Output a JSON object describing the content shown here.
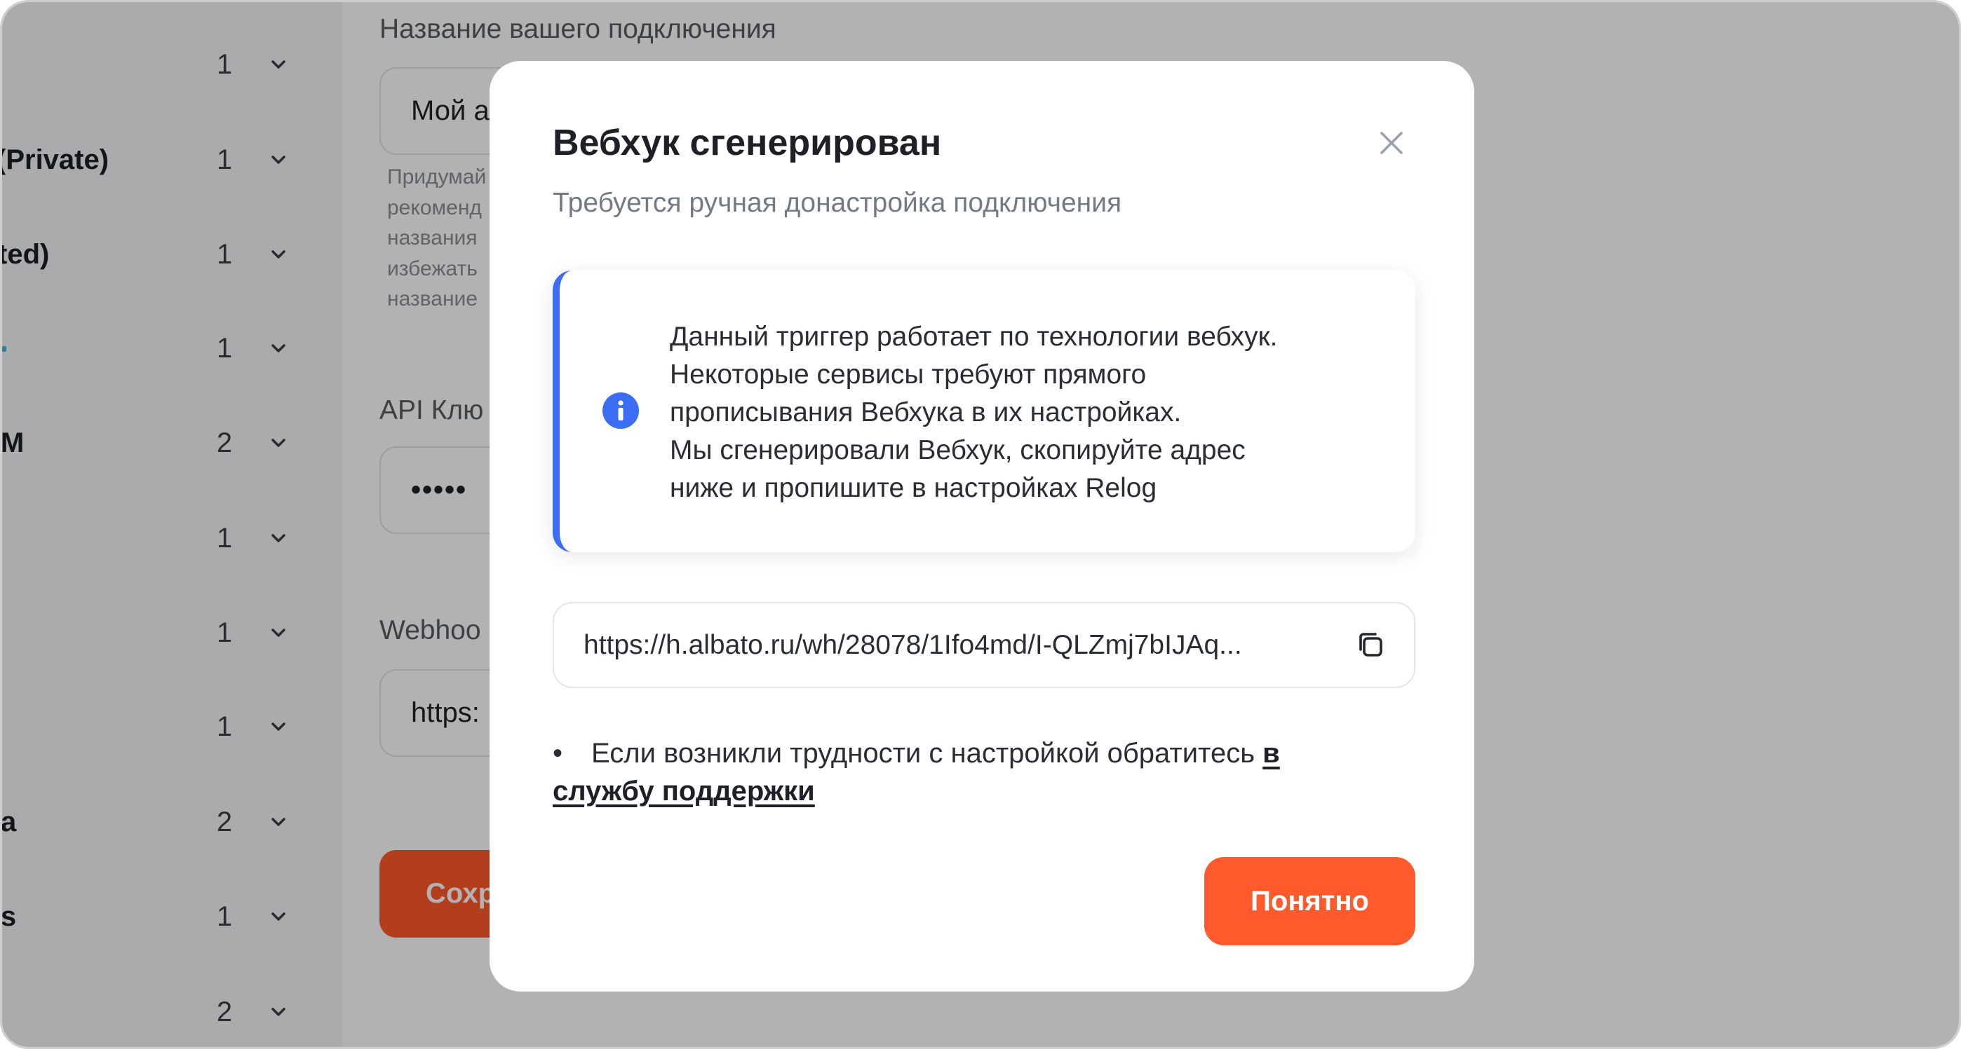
{
  "colors": {
    "accent": "#ff5a2c",
    "info": "#3b6ef5",
    "overlay": "rgba(0,0,0,0.30)"
  },
  "icons": [
    "chevron-down-icon",
    "close-icon",
    "info-icon",
    "copy-icon"
  ],
  "sidebar": {
    "items": [
      {
        "label": "",
        "count": "1"
      },
      {
        "label": "(Private)",
        "count": "1"
      },
      {
        "label": "ted)",
        "count": "1"
      },
      {
        "label": "",
        "count": "1"
      },
      {
        "label": "M",
        "count": "2"
      },
      {
        "label": "",
        "count": "1"
      },
      {
        "label": "",
        "count": "1"
      },
      {
        "label": "",
        "count": "1"
      },
      {
        "label": "a",
        "count": "2"
      },
      {
        "label": "s",
        "count": "1"
      },
      {
        "label": "",
        "count": "2"
      }
    ]
  },
  "form": {
    "connection_name": {
      "label": "Название вашего подключения",
      "value": "Мой а",
      "helper_lines": [
        "Придумай",
        "рекоменд",
        "названия",
        "избежать",
        "название"
      ]
    },
    "api_key": {
      "label": "API Клю",
      "value": "•••••"
    },
    "webhook": {
      "label": "Webhoo",
      "value": "https:"
    },
    "save_button": "Сохр"
  },
  "modal": {
    "title": "Вебхук сгенерирован",
    "subtitle": "Требуется ручная донастройка подключения",
    "info_lines": [
      "Данный триггер работает по технологии вебхук.",
      "Некоторые сервисы требуют прямого",
      "прописывания Вебхука в их настройках.",
      "Мы сгенерировали Вебхук, скопируйте адрес",
      "ниже и пропишите в настройках Relog"
    ],
    "webhook_url": "https://h.albato.ru/wh/28078/1Ifo4md/I-QLZmj7bIJAq...",
    "help": {
      "bullet": "•",
      "text": "Если возникли трудности с настройкой обратитесь ",
      "link": "в службу поддержки"
    },
    "confirm_button": "Понятно"
  }
}
